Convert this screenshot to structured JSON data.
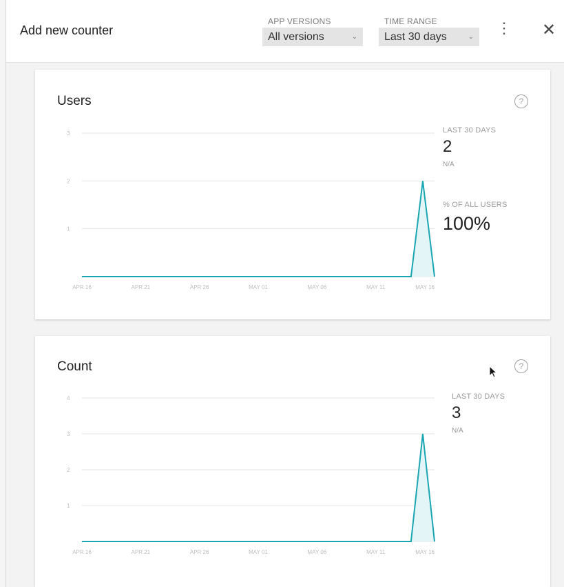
{
  "header": {
    "title": "Add new counter",
    "app_versions_label": "APP VERSIONS",
    "app_versions_value": "All versions",
    "time_range_label": "TIME RANGE",
    "time_range_value": "Last 30 days",
    "more_icon": "more-vert-icon",
    "close_icon": "close-icon"
  },
  "cards": [
    {
      "title": "Users",
      "help_icon": "help-icon",
      "stats": [
        {
          "label": "LAST 30 DAYS",
          "value": "2",
          "sub": "N/A"
        },
        {
          "label": "% OF ALL USERS",
          "value": "100%"
        }
      ]
    },
    {
      "title": "Count",
      "help_icon": "help-icon",
      "stats": [
        {
          "label": "LAST 30 DAYS",
          "value": "3",
          "sub": "N/A"
        }
      ]
    }
  ],
  "chart_data": [
    {
      "type": "area",
      "title": "Users",
      "xlabel": "",
      "ylabel": "",
      "x_ticks": [
        "APR 16",
        "APR 21",
        "APR 26",
        "MAY 01",
        "MAY 06",
        "MAY 11",
        "MAY 16"
      ],
      "y_ticks": [
        1,
        2,
        3
      ],
      "ylim": [
        0,
        3
      ],
      "x": [
        "APR 16",
        "APR 17",
        "APR 18",
        "APR 19",
        "APR 20",
        "APR 21",
        "APR 22",
        "APR 23",
        "APR 24",
        "APR 25",
        "APR 26",
        "APR 27",
        "APR 28",
        "APR 29",
        "APR 30",
        "MAY 01",
        "MAY 02",
        "MAY 03",
        "MAY 04",
        "MAY 05",
        "MAY 06",
        "MAY 07",
        "MAY 08",
        "MAY 09",
        "MAY 10",
        "MAY 11",
        "MAY 12",
        "MAY 13",
        "MAY 14",
        "MAY 15",
        "MAY 16"
      ],
      "values": [
        0,
        0,
        0,
        0,
        0,
        0,
        0,
        0,
        0,
        0,
        0,
        0,
        0,
        0,
        0,
        0,
        0,
        0,
        0,
        0,
        0,
        0,
        0,
        0,
        0,
        0,
        0,
        0,
        0,
        2,
        0
      ],
      "color": "#1aa5b3",
      "grid": true
    },
    {
      "type": "area",
      "title": "Count",
      "xlabel": "",
      "ylabel": "",
      "x_ticks": [
        "APR 16",
        "APR 21",
        "APR 26",
        "MAY 01",
        "MAY 06",
        "MAY 11",
        "MAY 16"
      ],
      "y_ticks": [
        1,
        2,
        3,
        4
      ],
      "ylim": [
        0,
        4
      ],
      "x": [
        "APR 16",
        "APR 17",
        "APR 18",
        "APR 19",
        "APR 20",
        "APR 21",
        "APR 22",
        "APR 23",
        "APR 24",
        "APR 25",
        "APR 26",
        "APR 27",
        "APR 28",
        "APR 29",
        "APR 30",
        "MAY 01",
        "MAY 02",
        "MAY 03",
        "MAY 04",
        "MAY 05",
        "MAY 06",
        "MAY 07",
        "MAY 08",
        "MAY 09",
        "MAY 10",
        "MAY 11",
        "MAY 12",
        "MAY 13",
        "MAY 14",
        "MAY 15",
        "MAY 16"
      ],
      "values": [
        0,
        0,
        0,
        0,
        0,
        0,
        0,
        0,
        0,
        0,
        0,
        0,
        0,
        0,
        0,
        0,
        0,
        0,
        0,
        0,
        0,
        0,
        0,
        0,
        0,
        0,
        0,
        0,
        0,
        3,
        0
      ],
      "color": "#1aa5b3",
      "grid": true
    }
  ]
}
